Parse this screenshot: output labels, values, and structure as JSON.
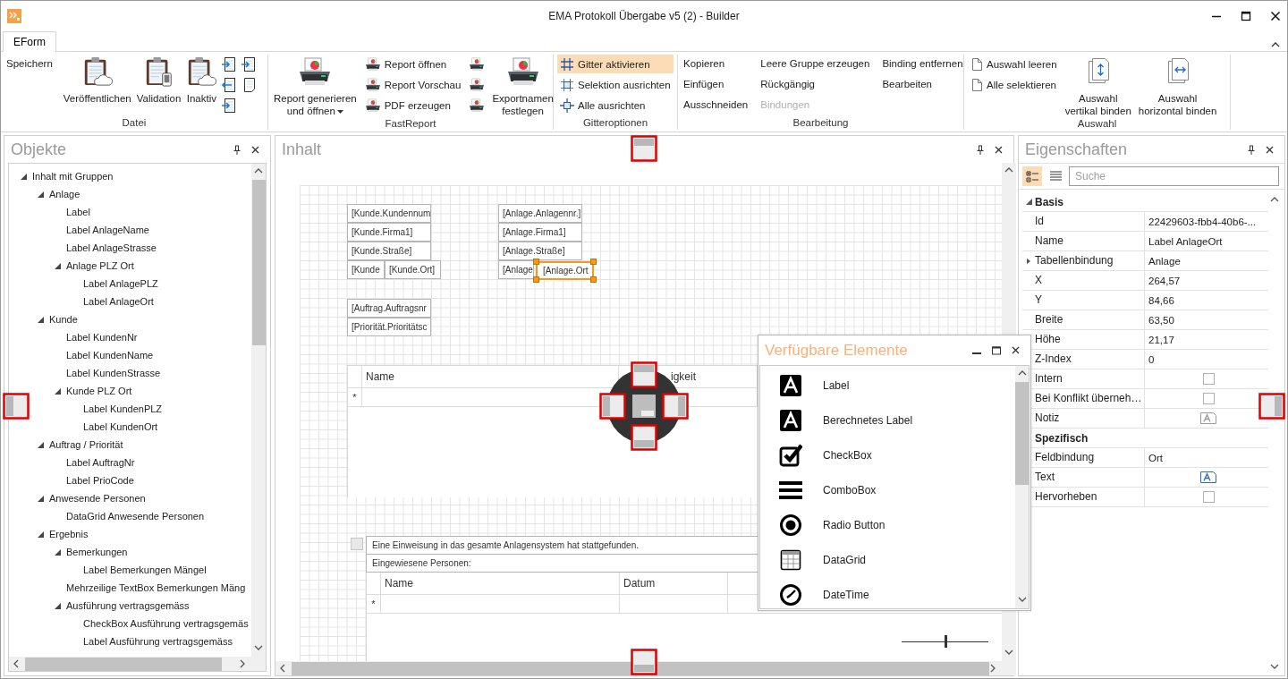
{
  "window": {
    "title": "EMA Protokoll Übergabe v5 (2) - Builder"
  },
  "ribbon_tabs": [
    {
      "label": "EForm",
      "selected": true
    }
  ],
  "ribbon_groups": [
    {
      "label": "Datei",
      "columns": [
        [
          {
            "kind": "text",
            "label": "Speichern"
          }
        ],
        [
          {
            "kind": "large",
            "label": "Veröffentlichen"
          }
        ],
        [
          {
            "kind": "large",
            "label": "Validation"
          }
        ],
        [
          {
            "kind": "large",
            "label": "Inaktiv"
          }
        ],
        [
          {
            "kind": "icon"
          },
          {
            "kind": "icon"
          },
          {
            "kind": "icon"
          }
        ],
        [
          {
            "kind": "icon"
          },
          {
            "kind": "icon"
          }
        ]
      ]
    },
    {
      "label": "FastReport",
      "columns": [
        [
          {
            "kind": "large",
            "label": "Report generieren\nund öffnen",
            "dropdown": true
          }
        ],
        [
          {
            "kind": "small",
            "label": "Report öffnen"
          },
          {
            "kind": "small",
            "label": "Report Vorschau"
          },
          {
            "kind": "small",
            "label": "PDF erzeugen"
          }
        ],
        [
          {
            "kind": "icon"
          },
          {
            "kind": "icon"
          },
          {
            "kind": "icon"
          }
        ],
        [
          {
            "kind": "large",
            "label": "Exportnamen\nfestlegen"
          }
        ]
      ]
    },
    {
      "label": "Gitteroptionen",
      "columns": [
        [
          {
            "kind": "small",
            "label": "Gitter aktivieren",
            "checked": true
          },
          {
            "kind": "small",
            "label": "Selektion ausrichten",
            "checked": false
          },
          {
            "kind": "small",
            "label": "Alle ausrichten",
            "checked": false
          }
        ]
      ]
    },
    {
      "label": "Bearbeitung",
      "columns": [
        [
          {
            "kind": "text",
            "label": "Kopieren",
            "disabled": false
          },
          {
            "kind": "text",
            "label": "Einfügen",
            "disabled": false
          },
          {
            "kind": "text",
            "label": "Ausschneiden",
            "disabled": false
          }
        ],
        [
          {
            "kind": "text",
            "label": "Leere Gruppe erzeugen",
            "disabled": false
          },
          {
            "kind": "text",
            "label": "Rückgängig",
            "disabled": false
          },
          {
            "kind": "text",
            "label": "Bindungen",
            "disabled": true
          }
        ],
        [
          {
            "kind": "text",
            "label": "Binding entfernen",
            "disabled": false
          },
          {
            "kind": "text",
            "label": "Bearbeiten",
            "disabled": false
          }
        ]
      ]
    },
    {
      "label": "Auswahl",
      "columns": [
        [
          {
            "kind": "small",
            "label": "Auswahl leeren"
          },
          {
            "kind": "small",
            "label": "Alle selektieren"
          }
        ],
        [
          {
            "kind": "large",
            "label": "Auswahl\nvertikal binden"
          }
        ],
        [
          {
            "kind": "large",
            "label": "Auswahl\nhorizontal binden"
          }
        ]
      ]
    }
  ],
  "objects_panel": {
    "title": "Objekte",
    "tree": [
      {
        "label": "Inhalt mit Gruppen",
        "expanded": true,
        "children": [
          {
            "label": "Anlage",
            "expanded": true,
            "children": [
              {
                "label": "Label"
              },
              {
                "label": "Label AnlageName"
              },
              {
                "label": "Label AnlageStrasse"
              },
              {
                "label": "Anlage PLZ Ort",
                "expanded": true,
                "children": [
                  {
                    "label": "Label AnlagePLZ"
                  },
                  {
                    "label": "Label AnlageOrt"
                  }
                ]
              }
            ]
          },
          {
            "label": "Kunde",
            "expanded": true,
            "children": [
              {
                "label": "Label KundenNr"
              },
              {
                "label": "Label KundenName"
              },
              {
                "label": "Label KundenStrasse"
              },
              {
                "label": "Kunde PLZ Ort",
                "expanded": true,
                "children": [
                  {
                    "label": "Label KundenPLZ"
                  },
                  {
                    "label": "Label KundenOrt"
                  }
                ]
              }
            ]
          },
          {
            "label": "Auftrag / Priorität",
            "expanded": true,
            "children": [
              {
                "label": "Label AuftragNr"
              },
              {
                "label": "Label PrioCode"
              }
            ]
          },
          {
            "label": "Anwesende Personen",
            "expanded": true,
            "children": [
              {
                "label": "DataGrid Anwesende Personen"
              }
            ]
          },
          {
            "label": "Ergebnis",
            "expanded": true,
            "children": [
              {
                "label": "Bemerkungen",
                "expanded": true,
                "children": [
                  {
                    "label": "Label Bemerkungen Mängel"
                  }
                ]
              },
              {
                "label": "Mehrzeilige TextBox Bemerkungen Mäng"
              },
              {
                "label": "Ausführung vertragsgemäss",
                "expanded": true,
                "children": [
                  {
                    "label": "CheckBox Ausführung vertragsgemäs"
                  },
                  {
                    "label": "Label Ausführung vertragsgemäss"
                  }
                ]
              }
            ]
          }
        ]
      }
    ]
  },
  "content_panel": {
    "title": "Inhalt",
    "fields": [
      {
        "text": "[Kunde.Kundennum",
        "selected": false
      },
      {
        "text": "[Kunde.Firma1]",
        "selected": false
      },
      {
        "text": "[Kunde.Straße]",
        "selected": false
      },
      {
        "text": "[Kunde",
        "selected": false
      },
      {
        "text": "[Kunde.Ort]",
        "selected": false
      },
      {
        "text": "[Anlage.Anlagennr.]",
        "selected": false
      },
      {
        "text": "[Anlage.Firma1]",
        "selected": false
      },
      {
        "text": "[Anlage.Straße]",
        "selected": false
      },
      {
        "text": "[Anlage",
        "selected": false
      },
      {
        "text": "[Anlage.Ort",
        "selected": true
      },
      {
        "text": "[Auftrag.Auftragsnr",
        "selected": false
      },
      {
        "text": "[Priorität.Prioritätsc",
        "selected": false
      }
    ],
    "grid": {
      "columns": [
        "Name",
        "igkeit"
      ],
      "new_row_marker": "*"
    },
    "group": {
      "checkbox": {
        "checked": false
      },
      "text": "Eine Einweisung in das gesamte Anlagensystem hat stattgefunden.",
      "label": "Eingewiesene Personen:",
      "grid": {
        "columns": [
          "Name",
          "Datum"
        ],
        "new_row_marker": "*"
      }
    },
    "zoom_slider": {
      "level": 0.5
    }
  },
  "floating_window": {
    "title": "Verfügbare Elemente",
    "items": [
      {
        "kind": "label",
        "label": "Label"
      },
      {
        "kind": "computed_label",
        "label": "Berechnetes Label"
      },
      {
        "kind": "checkbox",
        "label": "CheckBox"
      },
      {
        "kind": "combobox",
        "label": "ComboBox"
      },
      {
        "kind": "radio",
        "label": "Radio Button"
      },
      {
        "kind": "datagrid",
        "label": "DataGrid"
      },
      {
        "kind": "datetime",
        "label": "DateTime"
      }
    ]
  },
  "properties_panel": {
    "title": "Eigenschaften",
    "view_buttons": [
      {
        "selected": true
      },
      {
        "selected": false
      }
    ],
    "search": {
      "placeholder": "Suche"
    },
    "sections": [
      {
        "label": "Basis",
        "expanded": true,
        "rows": [
          {
            "kind": "text",
            "name": "Id",
            "value": "22429603-fbb4-40b6-..."
          },
          {
            "kind": "text",
            "name": "Name",
            "value": "Label AnlageOrt"
          },
          {
            "kind": "text",
            "name": "Tabellenbindung",
            "value": "Anlage",
            "expanded": false
          },
          {
            "kind": "text",
            "name": "X",
            "value": "264,57"
          },
          {
            "kind": "text",
            "name": "Y",
            "value": "84,66"
          },
          {
            "kind": "text",
            "name": "Breite",
            "value": "63,50"
          },
          {
            "kind": "text",
            "name": "Höhe",
            "value": "21,17"
          },
          {
            "kind": "text",
            "name": "Z-Index",
            "value": "0"
          },
          {
            "kind": "checkbox",
            "name": "Intern",
            "checked": false
          },
          {
            "kind": "checkbox",
            "name": "Bei Konflikt überneh…",
            "checked": false
          },
          {
            "kind": "editor",
            "name": "Notiz",
            "has_value": false
          }
        ]
      },
      {
        "label": "Spezifisch",
        "rows": [
          {
            "kind": "text",
            "name": "Feldbindung",
            "value": "Ort"
          },
          {
            "kind": "editor",
            "name": "Text",
            "has_value": true
          },
          {
            "kind": "checkbox",
            "name": "Hervorheben",
            "checked": false
          }
        ]
      }
    ]
  }
}
